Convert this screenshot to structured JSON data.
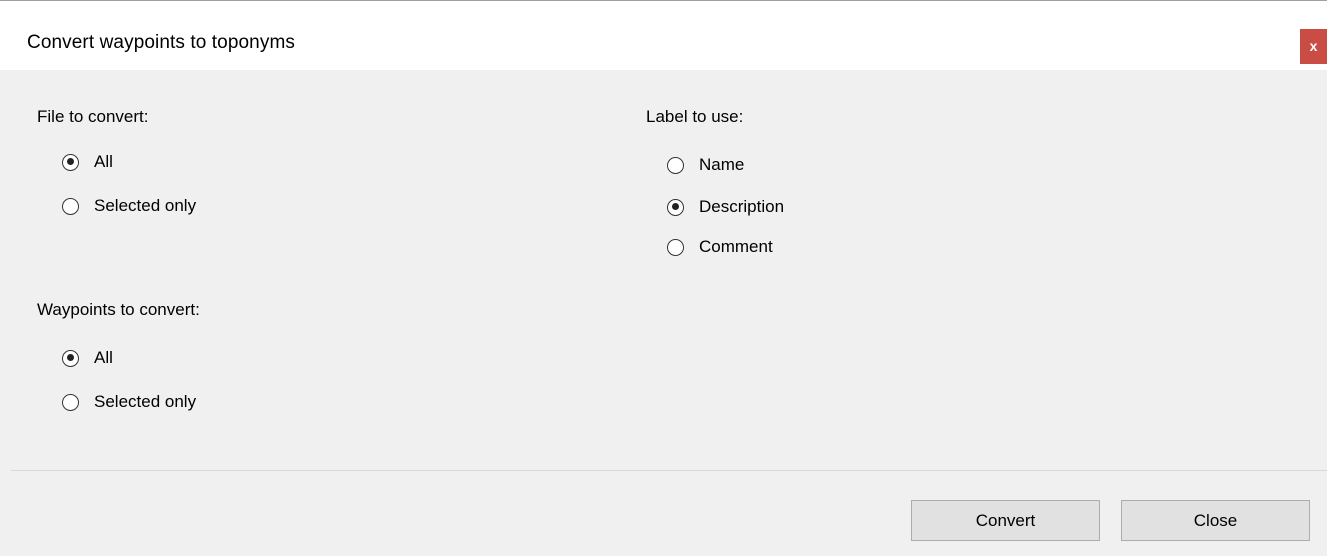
{
  "window": {
    "title": "Convert waypoints to toponyms",
    "close_label": "x"
  },
  "file_group": {
    "label": "File to convert:",
    "options": [
      {
        "label": "All",
        "checked": true
      },
      {
        "label": "Selected only",
        "checked": false
      }
    ]
  },
  "waypoints_group": {
    "label": "Waypoints to convert:",
    "options": [
      {
        "label": "All",
        "checked": true
      },
      {
        "label": "Selected only",
        "checked": false
      }
    ]
  },
  "label_group": {
    "label": "Label to use:",
    "options": [
      {
        "label": "Name",
        "checked": false
      },
      {
        "label": "Description",
        "checked": true
      },
      {
        "label": "Comment",
        "checked": false
      }
    ]
  },
  "buttons": {
    "convert_label": "Convert",
    "close_label": "Close"
  },
  "colors": {
    "close_accent": "#c94c45",
    "background": "#f0f0f0"
  }
}
